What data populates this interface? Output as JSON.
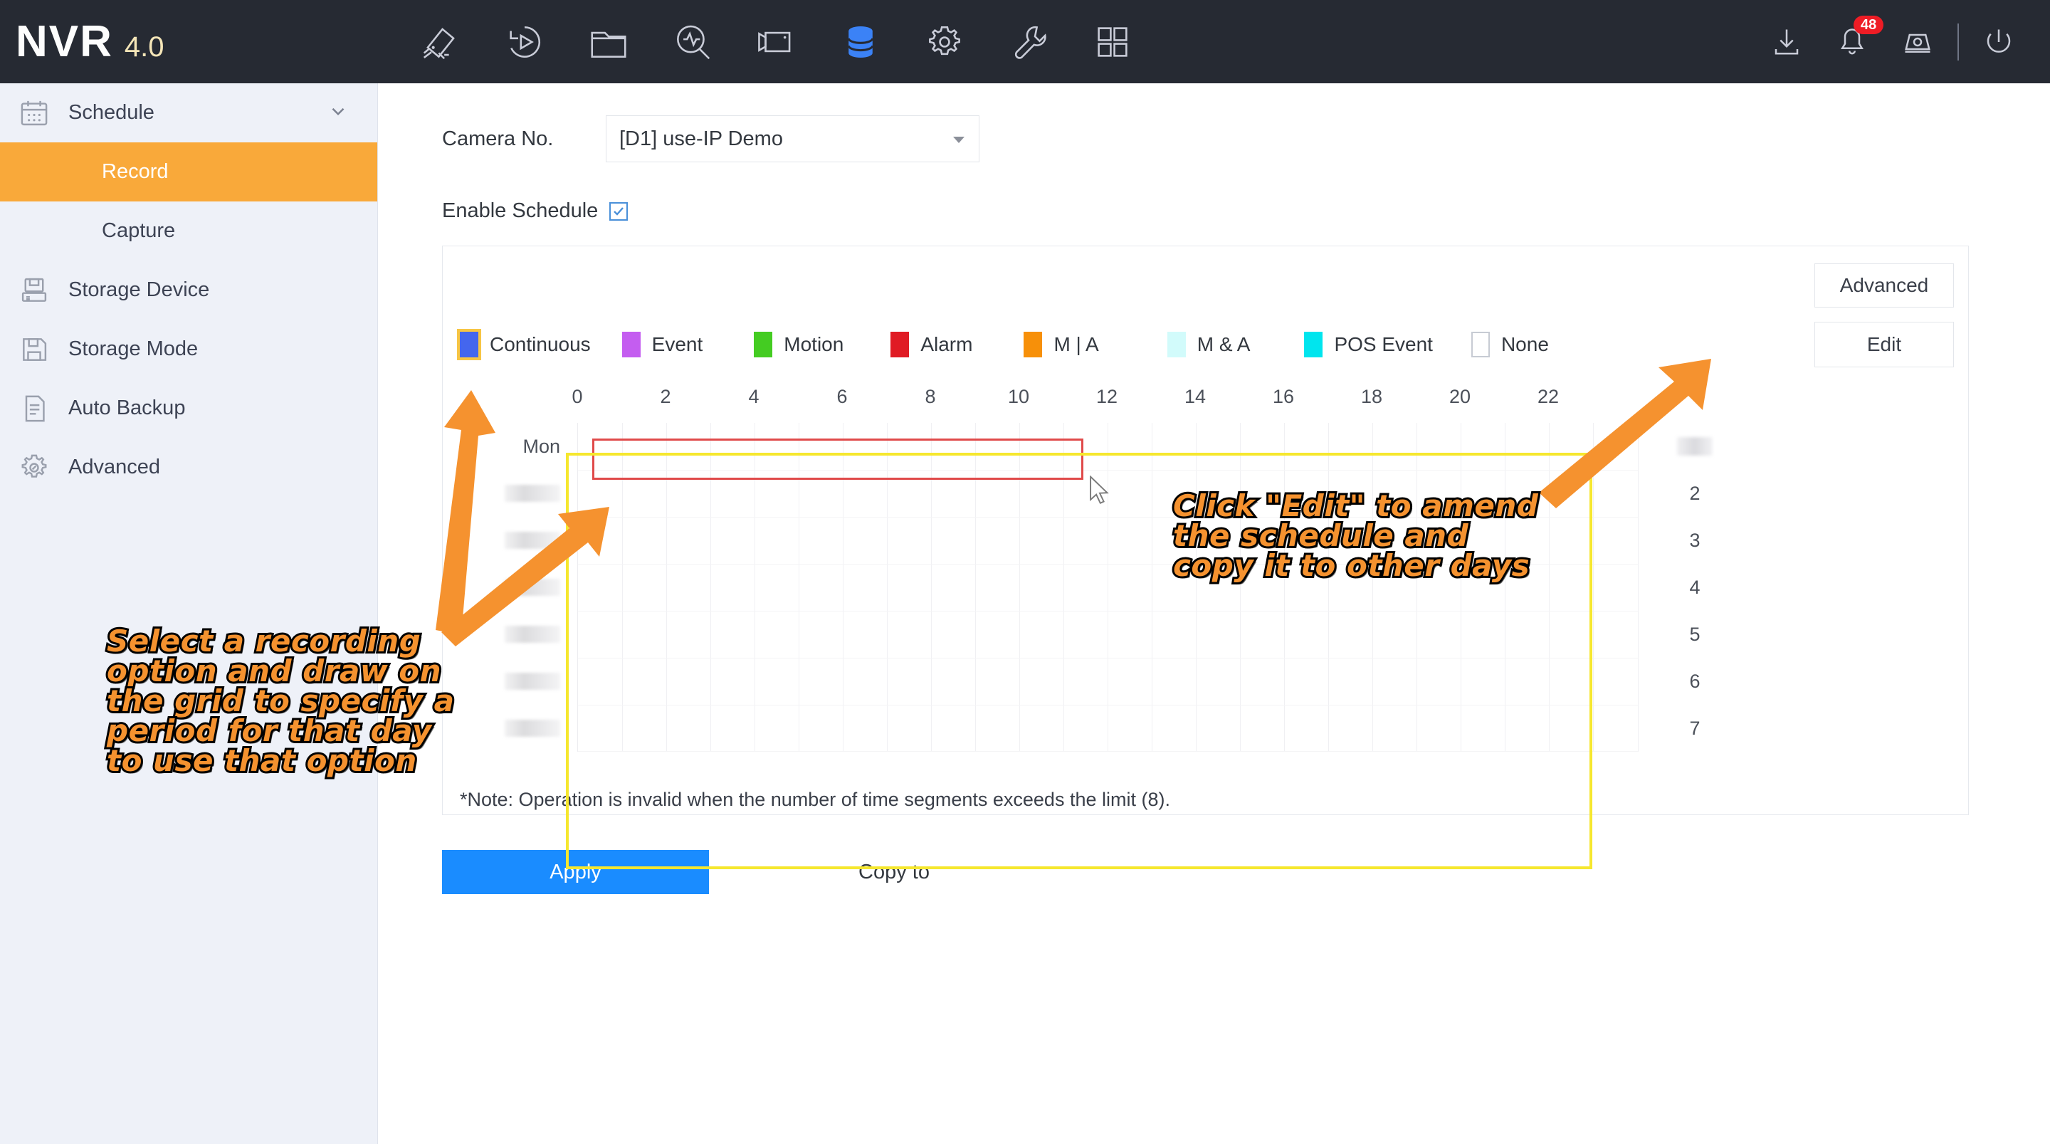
{
  "header": {
    "brand_name": "NVR",
    "brand_version": "4.0",
    "nav_icons": [
      {
        "name": "camera-icon",
        "active": false
      },
      {
        "name": "playback-icon",
        "active": false
      },
      {
        "name": "folder-icon",
        "active": false
      },
      {
        "name": "search-analytics-icon",
        "active": false
      },
      {
        "name": "video-camera-icon",
        "active": false
      },
      {
        "name": "storage-database-icon",
        "active": true
      },
      {
        "name": "settings-gear-icon",
        "active": false
      },
      {
        "name": "maintenance-wrench-icon",
        "active": false
      },
      {
        "name": "grid-apps-icon",
        "active": false
      }
    ],
    "right_icons": [
      {
        "name": "download-icon"
      },
      {
        "name": "notification-bell-icon",
        "badge": "48"
      },
      {
        "name": "alarm-siren-icon"
      },
      {
        "name": "power-icon"
      }
    ],
    "notification_count": "48",
    "active_accent_color": "#3b82f6",
    "background_color": "#262a33"
  },
  "sidebar": {
    "groups": [
      {
        "label": "Schedule",
        "icon": "calendar-icon",
        "expanded": true,
        "children": [
          {
            "label": "Record",
            "selected": true
          },
          {
            "label": "Capture",
            "selected": false
          }
        ]
      }
    ],
    "items": [
      {
        "label": "Storage Device",
        "icon": "storage-device-icon"
      },
      {
        "label": "Storage Mode",
        "icon": "floppy-disk-icon"
      },
      {
        "label": "Auto Backup",
        "icon": "document-list-icon"
      },
      {
        "label": "Advanced",
        "icon": "gear-advanced-icon"
      }
    ],
    "selected_color": "#f9a93a",
    "background_color": "#eef1f8"
  },
  "main": {
    "camera": {
      "label": "Camera No.",
      "selected_value": "[D1] use-IP Demo"
    },
    "enable_schedule": {
      "label": "Enable Schedule",
      "checked": true
    },
    "advanced_button": "Advanced",
    "edit_button": "Edit",
    "legend": [
      {
        "label": "Continuous",
        "color": "#4466ee",
        "selected": true
      },
      {
        "label": "Event",
        "color": "#c45df0",
        "selected": false
      },
      {
        "label": "Motion",
        "color": "#44cc22",
        "selected": false
      },
      {
        "label": "Alarm",
        "color": "#e01b24",
        "selected": false
      },
      {
        "label": "M | A",
        "color": "#f79009",
        "selected": false
      },
      {
        "label": "M & A",
        "color": "#d2fbfb",
        "selected": false
      },
      {
        "label": "POS Event",
        "color": "#00e5ee",
        "selected": false
      },
      {
        "label": "None",
        "color": "#ffffff",
        "selected": false
      }
    ],
    "note": "*Note: Operation is invalid when the number of time segments exceeds the limit (8).",
    "apply_button": "Apply",
    "copy_to_button": "Copy to"
  },
  "chart_data": {
    "type": "heatmap",
    "title": "Recording Schedule Grid",
    "xlabel": "",
    "ylabel": "",
    "hour_ticks": [
      "0",
      "2",
      "4",
      "6",
      "8",
      "10",
      "12",
      "14",
      "16",
      "18",
      "20",
      "22"
    ],
    "xlim": [
      0,
      24
    ],
    "day_rows": [
      {
        "label": "Mon",
        "blurred": false,
        "right_number": "",
        "right_blurred": true
      },
      {
        "label": "",
        "blurred": true,
        "right_number": "2",
        "right_blurred": false
      },
      {
        "label": "",
        "blurred": true,
        "right_number": "3",
        "right_blurred": false
      },
      {
        "label": "",
        "blurred": true,
        "right_number": "4",
        "right_blurred": false
      },
      {
        "label": "",
        "blurred": true,
        "right_number": "5",
        "right_blurred": false
      },
      {
        "label": "",
        "blurred": true,
        "right_number": "6",
        "right_blurred": false
      },
      {
        "label": "",
        "blurred": true,
        "right_number": "7",
        "right_blurred": false
      }
    ],
    "drawn_segment": {
      "day": "Mon",
      "start_hour": 0.3,
      "end_hour": 11.4,
      "outline_color": "#e04a4a"
    },
    "grid": true,
    "legend_position": "top"
  },
  "annotations": {
    "left_callout": "Select a recording\noption and draw on\nthe grid to specify a\nperiod for that day\nto use that option",
    "right_callout": "Click \"Edit\" to amend\nthe schedule and\ncopy it to other days",
    "arrow_color": "#f5922f",
    "highlight_box_color": "#f6e72e"
  }
}
